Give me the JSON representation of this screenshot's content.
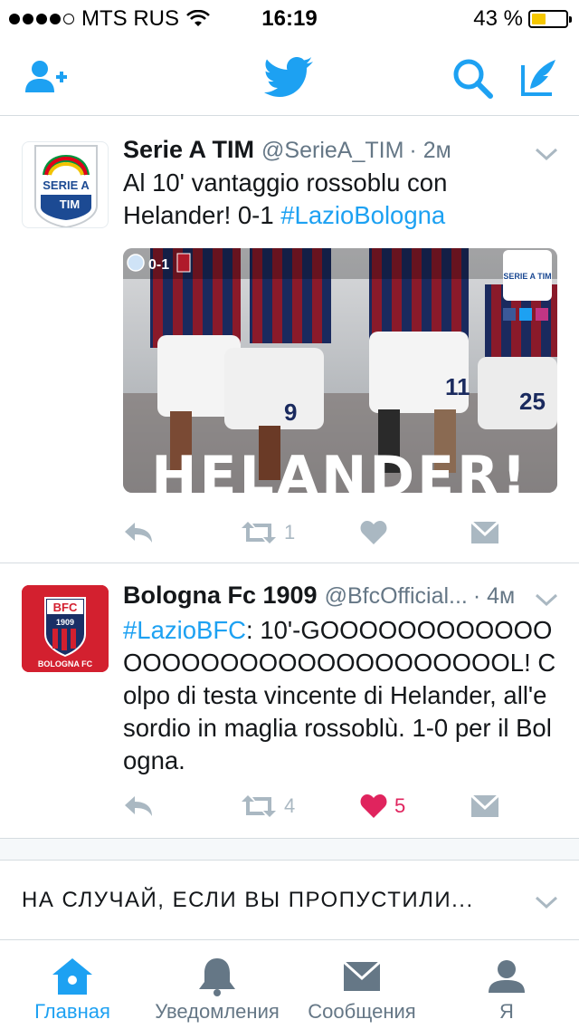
{
  "status_bar": {
    "carrier": "MTS RUS",
    "time": "16:19",
    "battery": "43 %",
    "battery_level": 0.43
  },
  "nav": {
    "icons": [
      "add-user-icon",
      "twitter-bird-icon",
      "search-icon",
      "compose-icon"
    ],
    "accent_color": "#1da1f2"
  },
  "tweets": [
    {
      "name": "Serie A TIM",
      "handle": "@SerieA_TIM",
      "time": "· 2м",
      "text_before": "Al 10' vantaggio rossoblu con Helander! 0-1 ",
      "hashtag": "#LazioBologna",
      "media": {
        "score_overlay": "0-1",
        "banner_text": "HELANDER!",
        "badge_text": "SERIE A TIM",
        "jersey_numbers": [
          "9",
          "11",
          "25"
        ]
      },
      "avatar": {
        "top_line": "SERIE A",
        "bottom_line": "TIM"
      },
      "retweets": "1",
      "likes": "",
      "liked": false
    },
    {
      "name": "Bologna Fc 1909",
      "handle": "@BfcOfficial...",
      "time": "· 4м",
      "hashtag": "#LazioBFC",
      "text_after": ": 10'-GOOOOOOOOOOOOOOOOOOOOOOOOOOOOOOOOL! Colpo di testa vincente di Helander, all'esordio in maglia rossoblù. 1-0 per il Bologna.",
      "avatar": {
        "top_line": "BFC",
        "year": "1909",
        "bottom_line": "BOLOGNA FC"
      },
      "retweets": "4",
      "likes": "5",
      "liked": true
    }
  ],
  "missed_section": {
    "label": "НА СЛУЧАЙ, ЕСЛИ ВЫ ПРОПУСТИЛИ..."
  },
  "tab_bar": {
    "tabs": [
      {
        "label": "Главная",
        "icon": "home-icon",
        "active": true
      },
      {
        "label": "Уведомления",
        "icon": "bell-icon",
        "active": false
      },
      {
        "label": "Сообщения",
        "icon": "envelope-icon",
        "active": false
      },
      {
        "label": "Я",
        "icon": "profile-icon",
        "active": false
      }
    ]
  }
}
